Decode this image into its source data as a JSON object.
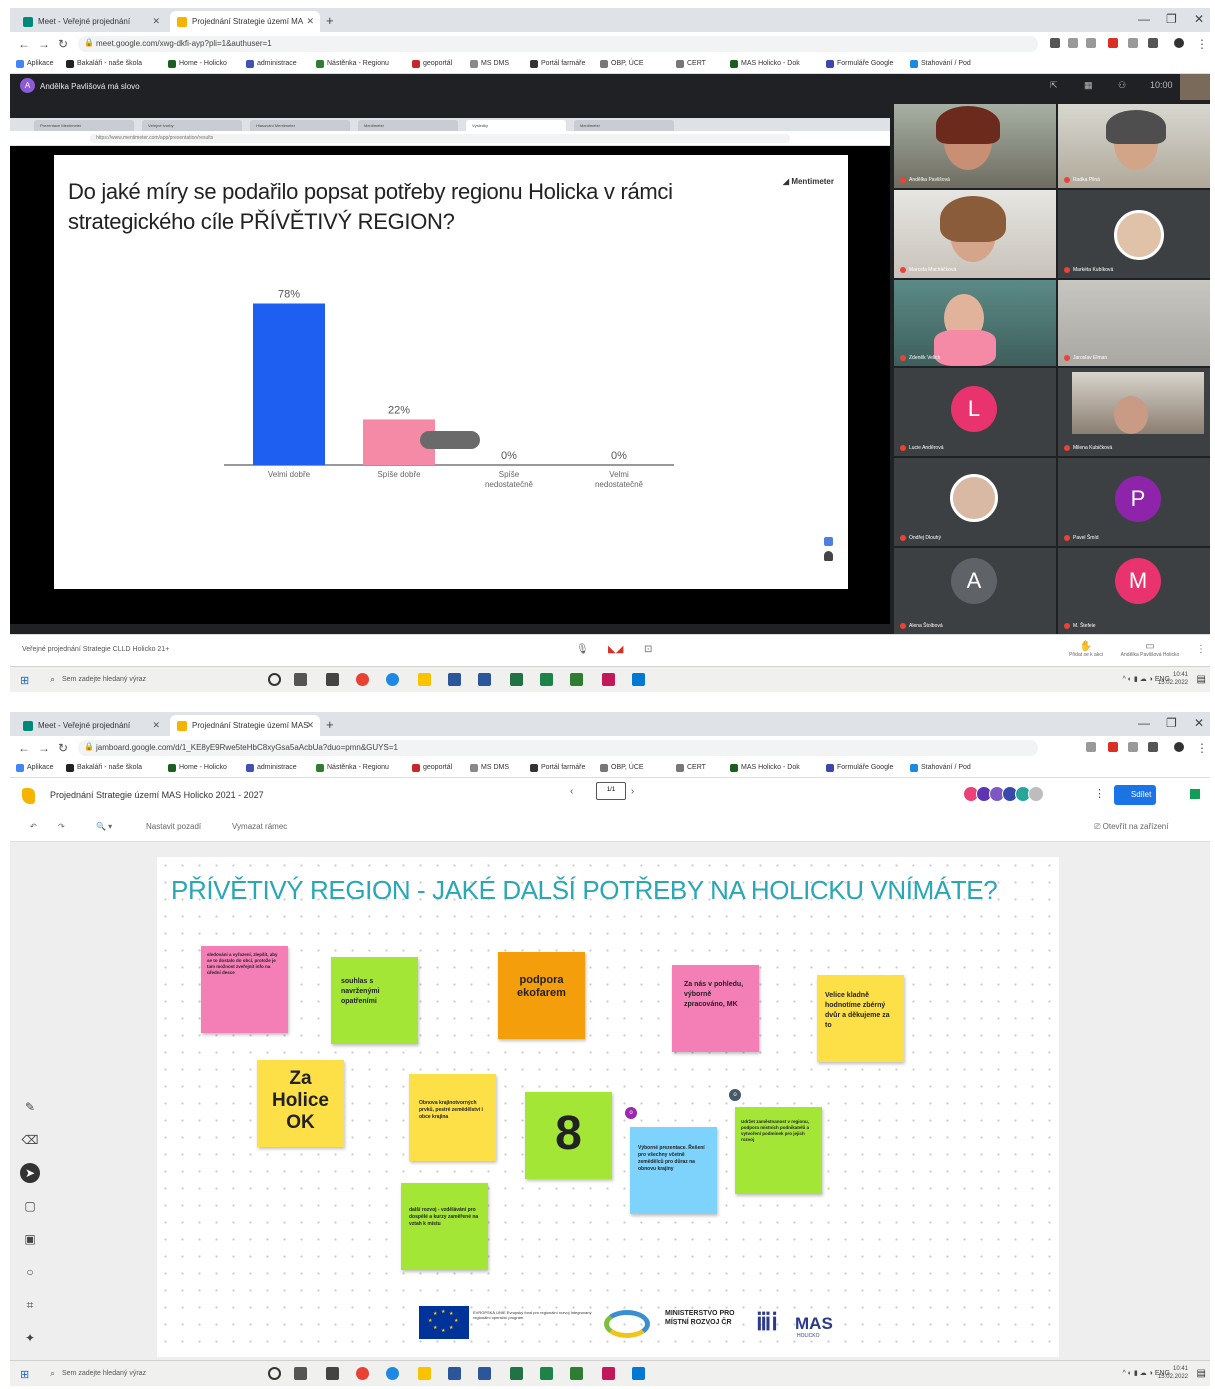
{
  "top_screenshot": {
    "tabs": [
      "Meet - Veřejné projednání",
      "Projednání Strategie území MA"
    ],
    "url": "meet.google.com/xwg-dkfi-ayp?pli=1&authuser=1",
    "bookmarks": [
      "Aplikace",
      "Bakaláři - naše škola",
      "Home - Holicko",
      "administrace",
      "Nástěnka - Regionu",
      "geoportál",
      "MS DMS",
      "Portál farmáře",
      "OBP, ÚCE",
      "CERT",
      "MAS Holicko - Dok",
      "Formuláře Google",
      "Stahování / Pod"
    ],
    "meet": {
      "presenting": "Andělka Pavlišová má slovo",
      "presenting_avatar": "A",
      "clock": "10:00",
      "shared_tabs": [
        "Prezentace Mentimeter",
        "Veřejné tvorby",
        "Hlasování Mentimeter",
        "Mentimeter",
        "Výsledky",
        "Mentimeter"
      ],
      "shared_url": "https://www.mentimeter.com/app/presentation/results",
      "question": "Do jaké míry se podařilo popsat potřeby regionu Holicka v rámci strategického cíle PŘÍVĚTIVÝ REGION?",
      "brand": "Mentimeter",
      "participants": [
        {
          "name": "Andělka Pavlišová"
        },
        {
          "name": "Radka Pilná"
        },
        {
          "name": "Marcela Macháčková"
        },
        {
          "name": "Markéta Kubíková"
        },
        {
          "name": "Zdeněk Velich"
        },
        {
          "name": "Jaroslav Elman"
        },
        {
          "name": "Lucie Anděrová",
          "initial": "L"
        },
        {
          "name": "Milena Kubičková"
        },
        {
          "name": "Ondřej Dlouhý"
        },
        {
          "name": "Pavel Šmíd",
          "initial": "P"
        },
        {
          "name": "Alena Štolbová",
          "initial": "A"
        },
        {
          "name": "M. Štefele",
          "initial": "M"
        }
      ],
      "bottom_title": "Veřejné projednání Strategie CLLD Holicko 21+",
      "bottom_right": [
        "Přidat se k akci",
        "Andělka Pavlišová Holicko"
      ]
    }
  },
  "chart_data": {
    "type": "bar",
    "categories": [
      "Velmi dobře",
      "Spíše dobře",
      "Spíše nedostatečně",
      "Velmi nedostatečně"
    ],
    "values": [
      78,
      22,
      0,
      0
    ],
    "value_labels": [
      "78%",
      "22%",
      "0%",
      "0%"
    ],
    "colors": [
      "#1e5ef0",
      "#f48aa6",
      "#7a7a7a",
      "#7a7a7a"
    ],
    "ylim": [
      0,
      100
    ],
    "grid": false
  },
  "bottom_screenshot": {
    "tabs": [
      "Meet - Veřejné projednání",
      "Projednání Strategie území MAS"
    ],
    "url": "jamboard.google.com/d/1_KE8yE9Rwe5teHbC8xyGsa5aAcbUa?duo=pmn&GUYS=1",
    "jam_title": "Projednání Strategie území MAS Holicko 2021 - 2027",
    "share_label": "Sdílet",
    "toolbar": [
      "Nastavit pozadí",
      "Vymazat rámec"
    ],
    "open_label": "Otevřít na zařízení",
    "frame_label": "1/1",
    "board_title": "PŘÍVĚTIVÝ REGION - JAKÉ DALŠÍ POTŘEBY NA HOLICKU VNÍMÁTE?",
    "stickies": [
      {
        "text": "sledování a vyřazení, zlepšit, aby se to dostalo do obcí, protože je tam možnost zveřejnit info na úřední desce",
        "color": "#f47fb6"
      },
      {
        "text": "souhlas s navrženými opatřeními",
        "color": "#a3e635"
      },
      {
        "text": "podpora ekofarem",
        "color": "#f59e0b"
      },
      {
        "text": "Za nás v pohledu, výborně zpracováno, MK",
        "color": "#f47fb6"
      },
      {
        "text": "Velice kladně hodnotíme zbérný dvůr a děkujeme za to",
        "color": "#fde047"
      },
      {
        "text": "Za Holice OK",
        "color": "#fde047"
      },
      {
        "text": "Obnova krajinotvorných prvků, pestré zemědělství i obce krajina",
        "color": "#fde047"
      },
      {
        "text": "8",
        "color": "#a3e635"
      },
      {
        "text": "Výborné prezentace. Řešení pro všechny včetně zemědělců pro důraz na obnovu krajiny",
        "color": "#7dd3fc"
      },
      {
        "text": "Udržet zaměstnanost v regionu, podpora místních podnikatelů a vytvoření podmínek pro jejich rozvoj",
        "color": "#a3e635"
      },
      {
        "text": "další rozvoj - vzdělávání pro dospělé a kurzy zaměřené na vztah k místu",
        "color": "#a3e635"
      }
    ],
    "logos": {
      "eu_text": "EVROPSKÁ UNIE Evropský fond pro regionální rozvoj Integrovaný regionální operační program",
      "ministry": "MINISTERSTVO PRO MÍSTNÍ ROZVOJ ČR",
      "mas": "MAS",
      "mas_sub": "HOLICKO"
    }
  },
  "taskbar": {
    "search": "Sem zadejte hledaný výraz",
    "time": "10:41",
    "date": "15.02.2022"
  }
}
